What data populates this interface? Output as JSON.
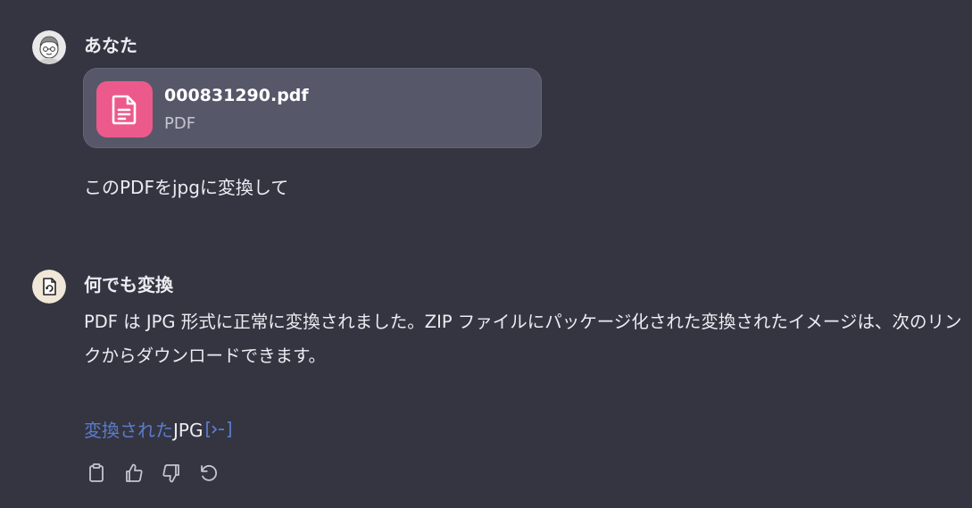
{
  "user_message": {
    "sender": "あなた",
    "attachment": {
      "file_name": "000831290.pdf",
      "file_type": "PDF",
      "icon": "document-icon",
      "icon_color": "#ec5a8b"
    },
    "text": "このPDFをjpgに変換して"
  },
  "assistant_message": {
    "sender": "何でも変換",
    "paragraphs": [
      "PDF は JPG 形式に正常に変換されました。ZIP ファイルにパッケージ化された変換されたイメージは、次のリンクからダウンロードできます。"
    ],
    "link": {
      "link_text": "変換された",
      "plain_text": "JPG",
      "icon": "external-link-icon",
      "link_color": "#5b7cc9"
    },
    "actions": [
      {
        "icon": "clipboard-icon"
      },
      {
        "icon": "thumbs-up-icon"
      },
      {
        "icon": "thumbs-down-icon"
      },
      {
        "icon": "regenerate-icon"
      }
    ]
  },
  "colors": {
    "background": "#343541",
    "card_background": "#565869",
    "text": "#ececf1"
  }
}
